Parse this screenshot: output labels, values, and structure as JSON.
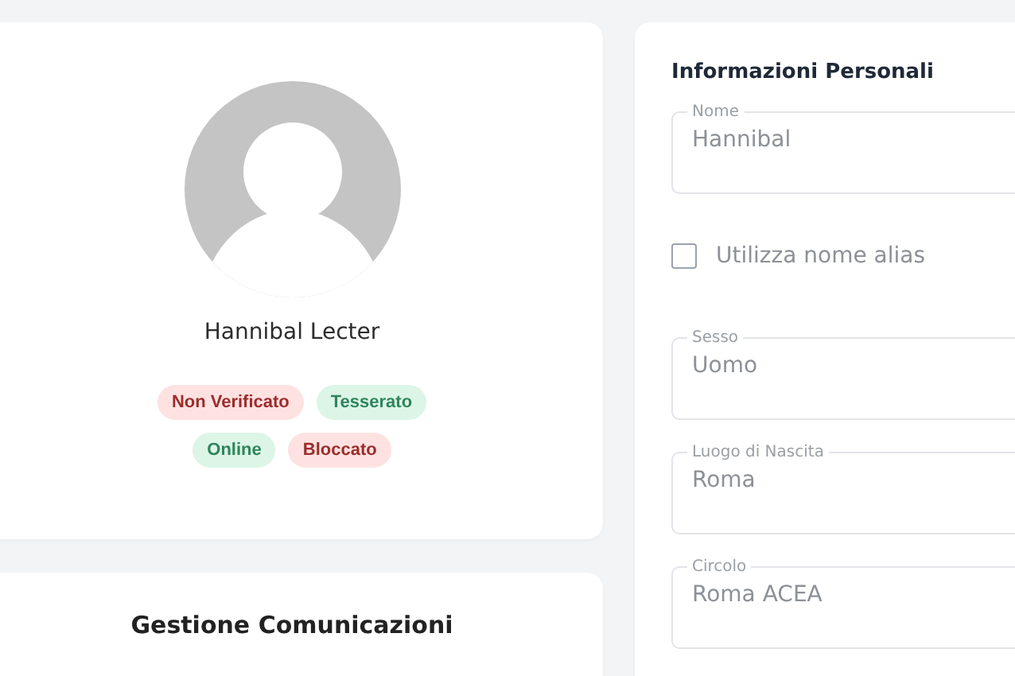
{
  "profile": {
    "name": "Hannibal Lecter",
    "badges": [
      {
        "label": "Non Verificato",
        "kind": "danger"
      },
      {
        "label": "Tesserato",
        "kind": "success"
      },
      {
        "label": "Online",
        "kind": "success"
      },
      {
        "label": "Bloccato",
        "kind": "danger"
      }
    ]
  },
  "communications": {
    "title": "Gestione Comunicazioni"
  },
  "personal_info": {
    "title": "Informazioni Personali",
    "name_field": {
      "label": "Nome",
      "value": "Hannibal"
    },
    "alias_checkbox": {
      "label": "Utilizza nome alias",
      "checked": false
    },
    "fields": [
      {
        "label": "Sesso",
        "value": "Uomo"
      },
      {
        "label": "Luogo di Nascita",
        "value": "Roma"
      },
      {
        "label": "Circolo",
        "value": "Roma ACEA"
      }
    ]
  }
}
